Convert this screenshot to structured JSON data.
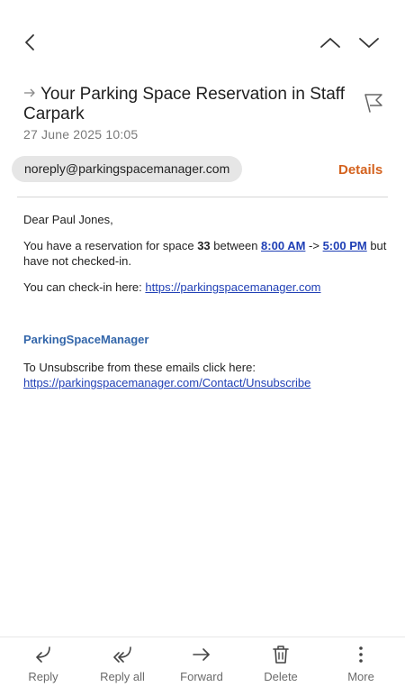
{
  "email": {
    "subject": "Your Parking Space Reservation in Staff Carpark",
    "date": "27 June 2025  10:05",
    "sender": "noreply@parkingspacemanager.com",
    "details_label": "Details"
  },
  "body": {
    "greeting": "Dear Paul Jones,",
    "reservation_prefix": "You have a reservation for space ",
    "space_number": "33",
    "between_text": " between ",
    "start_time": "8:00 AM",
    "arrow_text": " -> ",
    "end_time": "5:00 PM",
    "reservation_suffix": " but have not checked-in.",
    "checkin_prefix": "You can check-in here: ",
    "checkin_link": "https://parkingspacemanager.com",
    "brand": "ParkingSpaceManager",
    "unsubscribe_text": "To Unsubscribe from these emails click here:",
    "unsubscribe_link": "https://parkingspacemanager.com/Contact/Unsubscribe"
  },
  "toolbar": {
    "reply": "Reply",
    "reply_all": "Reply all",
    "forward": "Forward",
    "delete": "Delete",
    "more": "More"
  },
  "icons": {
    "back": "back-arrow-icon",
    "up": "chevron-up-icon",
    "down": "chevron-down-icon",
    "forwarded": "forward-arrow-icon",
    "flag": "flag-icon",
    "reply": "reply-icon",
    "reply_all": "reply-all-icon",
    "forward": "forward-icon",
    "delete": "trash-icon",
    "more": "more-vertical-icon"
  },
  "colors": {
    "details": "#d4621e",
    "link": "#1f3fb5",
    "brand": "#3366aa",
    "chip": "#e6e6e6"
  }
}
